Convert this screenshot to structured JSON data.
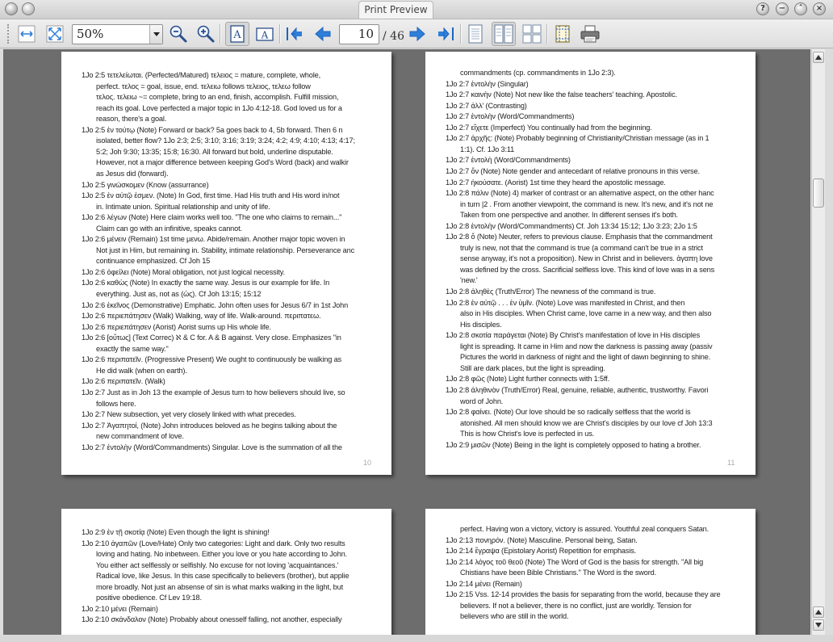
{
  "window": {
    "title": "Print Preview",
    "buttons": [
      "?",
      "−",
      "˄",
      "×"
    ]
  },
  "toolbar": {
    "zoom_value": "50%",
    "current_page": "10",
    "total_pages": "/ 46",
    "tools": [
      {
        "name": "fit-width-icon",
        "interactable": true
      },
      {
        "name": "fit-page-icon",
        "interactable": true
      },
      {
        "name": "zoom-out-icon",
        "interactable": true
      },
      {
        "name": "zoom-in-icon",
        "interactable": true
      },
      {
        "name": "portrait-icon",
        "interactable": true,
        "active": true
      },
      {
        "name": "landscape-icon",
        "interactable": true
      },
      {
        "name": "first-page-icon",
        "interactable": true
      },
      {
        "name": "previous-page-icon",
        "interactable": true
      },
      {
        "name": "next-page-icon",
        "interactable": true
      },
      {
        "name": "last-page-icon",
        "interactable": true
      },
      {
        "name": "single-page-icon",
        "interactable": true
      },
      {
        "name": "facing-pages-icon",
        "interactable": true,
        "active": true
      },
      {
        "name": "overview-icon",
        "interactable": true
      },
      {
        "name": "page-setup-icon",
        "interactable": true
      },
      {
        "name": "print-icon",
        "interactable": true
      }
    ]
  },
  "colors": {
    "accent_blue": "#2f7fd8",
    "page_gray": "#6d6d6d",
    "note_gray": "#777777",
    "greek_brown": "#5a3a1a",
    "aorist_orange": "#e8862a",
    "imperfect_cyan": "#3bb7e0",
    "demonstrative_purple": "#7a5fc6",
    "text_green": "#2fb24a",
    "contrast_red": "#c04040"
  },
  "pages": {
    "p10": {
      "number": "10",
      "lines": [
        "1Jo 2:5 τετελείωται. (Perfected/Matured) τελειος = mature, complete, whole,",
        "perfect. τελος = goal, issue, end. τελειω follows τελειος, τελεω follow",
        "τελος. τελειω ~= complete, bring to an end, finish, accomplish. Fulfill mission,",
        "reach its goal. Love perfected a major topic in 1Jo 4:12-18. God loved us for a",
        "reason, there's a goal.",
        "1Jo 2:5 ἐν τούτῳ (Note) Forward or back? 5a goes back to 4, 5b forward. Then 6 n",
        "isolated, better flow? 1Jo 2:3; 2:5; 3:10; 3:16; 3:19; 3:24; 4:2; 4:9; 4:10; 4:13; 4:17;",
        "5:2; Joh 9:30; 13:35; 15:8; 16:30. All forward but bold, underline disputable.",
        "However, not a major difference between keeping God's Word (back) and walkir",
        "as Jesus did (forward).",
        "1Jo 2:5 γινώσκομεν (Know (assurrance)",
        "1Jo 2:5 ἐν αὐτῷ ἐσμεν. (Note) In God, first time. Had His truth and His word in/not",
        "in. Intimate union. Spiritual relationship and unity of life.",
        "1Jo 2:6 λέγων (Note) Here claim works well too. \"The one who claims to remain...\"",
        "Claim can go with an infinitive, speaks cannot.",
        "1Jo 2:6 μένειν (Remain) 1st time μενω. Abide/remain. Another major topic woven in",
        "Not just in Him, but remaining in. Stability, intimate relationship. Perseverance anc",
        "continuance emphasized. Cf Joh 15",
        "1Jo 2:6 ὀφείλει (Note) Moral obligation, not just logical necessity.",
        "1Jo 2:6 καθὼς (Note) In exactly the same way. Jesus is our example for life. In",
        "everything. Just as, not as (ὡς). Cf Joh 13:15; 15:12",
        "1Jo 2:6 ἐκεῖνος (Demonstrative) Emphatic. John often uses for Jesus 6/7 in 1st John",
        "1Jo 2:6 περιεπάτησεν (Walk) Walking, way of life. Walk-around. περιπατεω.",
        "1Jo 2:6 περιεπάτησεν (Aorist) Aorist sums up His whole life.",
        "1Jo 2:6 [οὕτως] (Text Correc) ℵ & C for. A & B against. Very close. Emphasizes \"in",
        "exactly the same way.\"",
        "1Jo 2:6 περιπατεῖν. (Progressive Present) We ought to continuously be walking as",
        "He did walk (when on earth).",
        "1Jo 2:6 περιπατεῖν. (Walk)",
        "1Jo 2:7 Just as in Joh 13 the example of Jesus turn to how believers should live, so",
        "follows here.",
        "1Jo 2:7 New subsection, yet very closely linked with what precedes.",
        "1Jo 2:7 Ἀγαπητοί, (Note) John introduces beloved as he begins talking about the",
        "new commandment of love.",
        "1Jo 2:7 ἐντολὴν (Word/Commandments) Singular. Love is the summation of all the"
      ]
    },
    "p11": {
      "number": "11",
      "lines": [
        "commandments (cp. commandments in 1Jo 2:3).",
        "1Jo 2:7 ἐντολὴν (Singular)",
        "1Jo 2:7 καινὴν (Note) Not new like the false teachers' teaching. Apostolic.",
        "1Jo 2:7 ἀλλ' (Contrasting)",
        "1Jo 2:7 ἐντολὴν (Word/Commandments)",
        "1Jo 2:7 εἴχετε (Imperfect) You continually had from the beginning.",
        "1Jo 2:7 ἀρχῆς: (Note) Probably beginning of Christianity/Christian message (as in 1",
        "1:1). Cf. 1Jo 3:11",
        "1Jo 2:7 ἐντολὴ (Word/Commandments)",
        "1Jo 2:7 ὅν (Note) Note gender and antecedant of relative pronouns in this verse.",
        "1Jo 2:7 ἠκούσατε. (Aorist) 1st time they heard the apostolic message.",
        "1Jo 2:8 πάλιν (Note) 4) marker of contrast or an alternative aspect, on the other hanc",
        "in turn |2 . From another viewpoint, the command is new. It's new, and it's not ne",
        "Taken from one perspective and another. In different senses it's both.",
        "1Jo 2:8 ἐντολὴν (Word/Commandments) Cf. Joh 13:34 15:12; 1Jo 3:23; 2Jo 1:5",
        "1Jo 2:8 ὅ (Note) Neuter, refers to previous clause. Emphasis that the commandment",
        "truly is new, not that the command is true (a command can't be true in a strict",
        "sense anyway, it's not a proposition). New in Christ and in believers. ἀγαπη love",
        "was defined by the cross. Sacrificial selfless love. This kind of love was in a sens",
        "'new.'",
        "1Jo 2:8 ἀληθὲς (Truth/Error) The newness of the command is true.",
        "1Jo 2:8 ἐν αὐτῷ . . . ἐν ὑμῖν. (Note) Love was manifested in Christ, and then",
        "also in His disciples. When Christ came, love came in a new way, and then also",
        "His disciples.",
        "1Jo 2:8 σκοτία παράγεται (Note) By Christ's manifestation of love in His disciples",
        "light is spreading. It came in Him and now the darkness is passing away (passiv",
        "Pictures the world in darkness of night and the light of dawn beginning to shine.",
        "Still are dark places, but the light is spreading.",
        "1Jo 2:8 φῶς (Note) Light further connects with 1:5ff.",
        "1Jo 2:8 ἀληθινὸν (Truth/Error) Real, genuine, reliable, authentic, trustworthy. Favori",
        "word of John.",
        "1Jo 2:8 φαίνει. (Note) Our love should be so radically selfless that the world is",
        "atonished. All men should know we are Christ's disciples by our love cf Joh 13:3",
        "This is how Christ's love is perfected in us.",
        "1Jo 2:9 μισῶν (Note) Being in the light is completely opposed to hating a brother."
      ]
    },
    "p12": {
      "lines": [
        "1Jo 2:9 ἐν τῇ σκοτίᾳ (Note) Even though the light is shining!",
        "1Jo 2:10 ἀγαπῶν (Love/Hate) Only two categories: Light and dark. Only two results",
        "loving and hating. No inbetween. Either you love or you hate according to John.",
        "You either act selflessly or selfishly. No excuse for not loving 'acquaintances.'",
        "Radical love, like Jesus. In this case specifically to believers (brother), but applie",
        "more broadly. Not just an absense of sin is what marks walking in the light, but",
        "positive obedience. Cf Lev 19:18.",
        "1Jo 2:10 μένει (Remain)",
        "1Jo 2:10 σκάνδαλον (Note) Probably about onesself falling, not another, especially"
      ]
    },
    "p13": {
      "lines": [
        "perfect. Having won a victory, victory is assured. Youthful zeal conquers Satan.",
        "1Jo 2:13 πονηρόν. (Note) Masculine. Personal being, Satan.",
        "1Jo 2:14 ἔγραψα (Epistolary Aorist) Repetition for emphasis.",
        "1Jo 2:14 λόγος τοῦ θεοῦ (Note) The Word of God is the basis for strength. \"All big",
        "Chistians have been Bible Christians.\" The Word is the sword.",
        "1Jo 2:14 μένει (Remain)",
        "1Jo 2:15 Vss. 12-14 provides the basis for separating from the world, because they are",
        "believers. If not a believer, there is no conflict, just are worldly. Tension for",
        "believers who are still in the world."
      ]
    }
  }
}
